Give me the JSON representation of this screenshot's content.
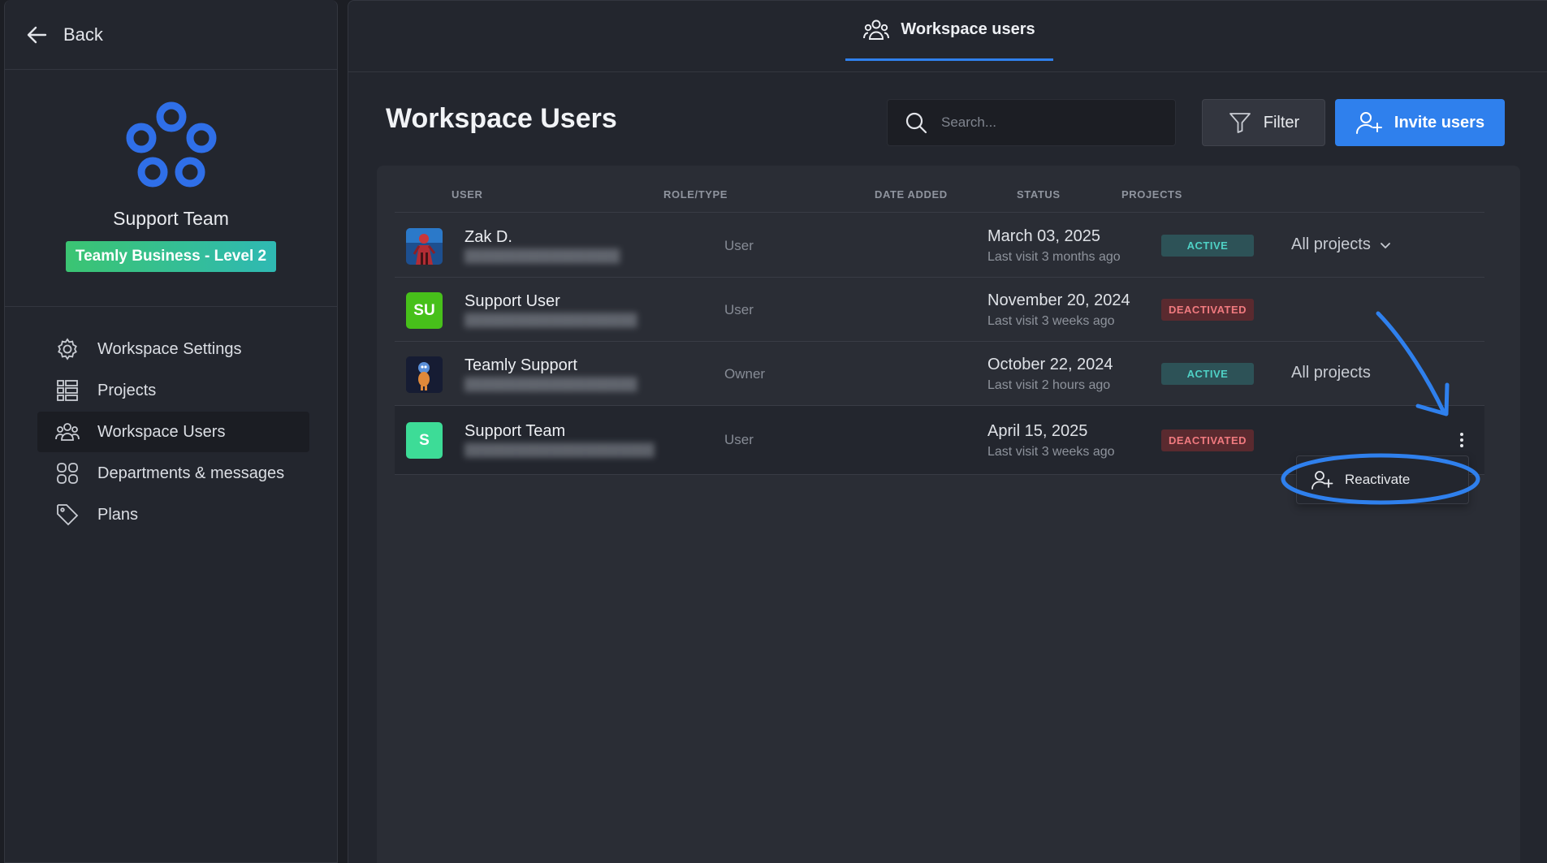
{
  "sidebar": {
    "back_label": "Back",
    "workspace_name": "Support Team",
    "plan_badge": "Teamly Business - Level 2",
    "items": [
      {
        "label": "Workspace Settings",
        "icon": "gear-icon"
      },
      {
        "label": "Projects",
        "icon": "projects-list-icon"
      },
      {
        "label": "Workspace Users",
        "icon": "users-icon",
        "active": true
      },
      {
        "label": "Departments & messages",
        "icon": "grid-icon"
      },
      {
        "label": "Plans",
        "icon": "tag-icon"
      }
    ]
  },
  "header": {
    "tab_label": "Workspace users"
  },
  "main": {
    "title": "Workspace Users",
    "search_placeholder": "Search...",
    "filter_label": "Filter",
    "invite_label": "Invite users"
  },
  "table": {
    "columns": [
      "USER",
      "ROLE/TYPE",
      "DATE ADDED",
      "STATUS",
      "PROJECTS"
    ],
    "rows": [
      {
        "name": "Zak D.",
        "avatar": "photo",
        "role": "User",
        "date": "March 03, 2025",
        "visit": "Last visit 3 months ago",
        "status": "ACTIVE",
        "projects": "All projects"
      },
      {
        "name": "Support User",
        "avatar": "SU",
        "role": "User",
        "date": "November 20, 2024",
        "visit": "Last visit 3 weeks ago",
        "status": "DEACTIVATED",
        "projects": ""
      },
      {
        "name": "Teamly Support",
        "avatar": "mascot",
        "role": "Owner",
        "date": "October 22, 2024",
        "visit": "Last visit 2 hours ago",
        "status": "ACTIVE",
        "projects": "All projects"
      },
      {
        "name": "Support Team",
        "avatar": "S",
        "role": "User",
        "date": "April 15, 2025",
        "visit": "Last visit 3 weeks ago",
        "status": "DEACTIVATED",
        "projects": ""
      }
    ]
  },
  "context_menu": {
    "reactivate_label": "Reactivate"
  },
  "colors": {
    "accent": "#2f80ed",
    "active_status": "#4fd1c5",
    "deactivated_status": "#f07a7f",
    "avatar_su": "#47c01a",
    "avatar_s": "#3ddc97"
  }
}
